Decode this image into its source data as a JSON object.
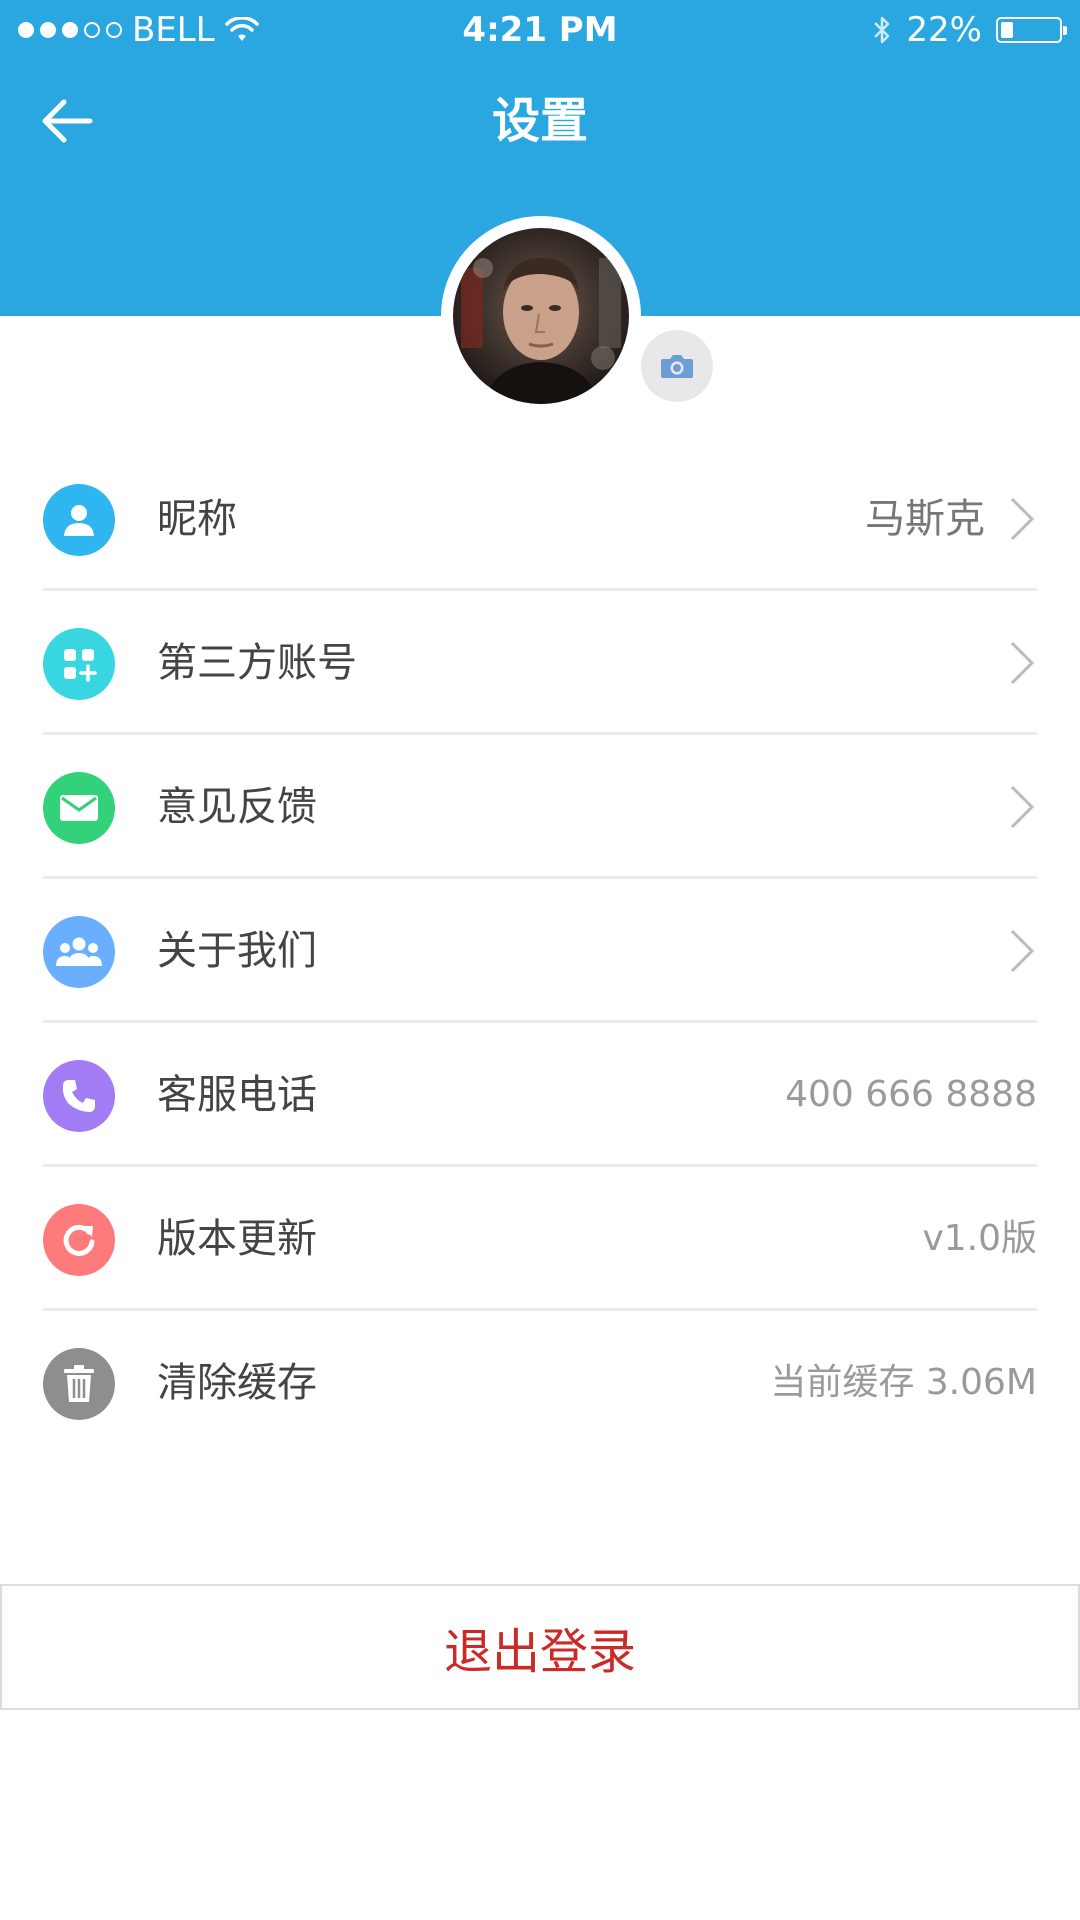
{
  "status_bar": {
    "carrier": "BELL",
    "time": "4:21 PM",
    "battery_percent": "22%",
    "battery_level": 0.22,
    "signal_dots_filled": 3,
    "signal_dots_total": 5,
    "icons": [
      "wifi-icon",
      "bluetooth-icon",
      "battery-icon"
    ]
  },
  "header": {
    "title": "设置",
    "back_icon": "arrow-left-icon",
    "background_color": "#2aa7e0"
  },
  "profile": {
    "avatar_icon": "avatar-photo",
    "camera_icon": "camera-icon"
  },
  "settings": {
    "items": [
      {
        "label": "昵称",
        "value": "马斯克",
        "icon": "user-icon",
        "icon_color": "#2fb6f1",
        "has_chevron": true
      },
      {
        "label": "第三方账号",
        "value": "",
        "icon": "apps-plus-icon",
        "icon_color": "#37d6e0",
        "has_chevron": true
      },
      {
        "label": "意见反馈",
        "value": "",
        "icon": "mail-icon",
        "icon_color": "#33d17a",
        "has_chevron": true
      },
      {
        "label": "关于我们",
        "value": "",
        "icon": "group-icon",
        "icon_color": "#6aaeff",
        "has_chevron": true
      },
      {
        "label": "客服电话",
        "value": "400 666 8888",
        "icon": "phone-icon",
        "icon_color": "#a17cf5",
        "has_chevron": false
      },
      {
        "label": "版本更新",
        "value": "v1.0版",
        "icon": "refresh-icon",
        "icon_color": "#ff7b7b",
        "has_chevron": false
      },
      {
        "label": "清除缓存",
        "value": "当前缓存 3.06M",
        "icon": "trash-icon",
        "icon_color": "#8e8e8e",
        "has_chevron": false
      }
    ]
  },
  "logout": {
    "label": "退出登录",
    "color": "#cc2a26"
  }
}
